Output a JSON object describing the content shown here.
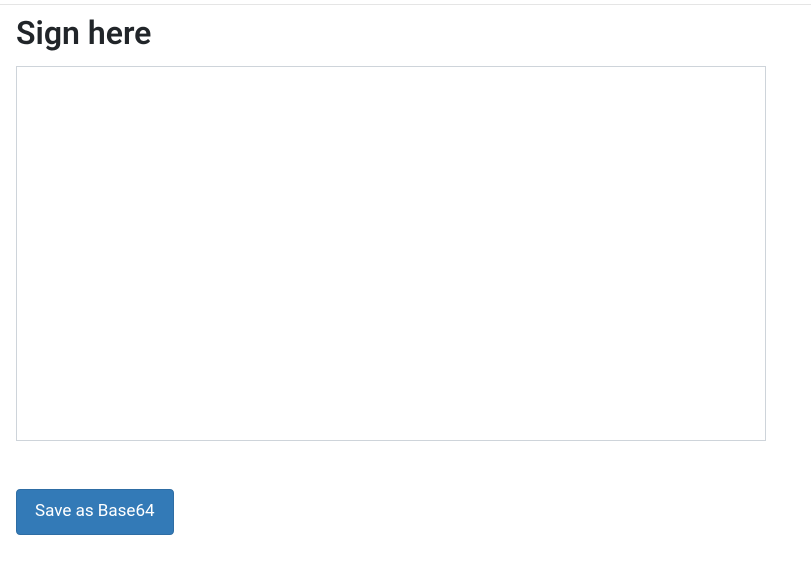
{
  "heading": "Sign here",
  "actions": {
    "save_label": "Save as Base64"
  }
}
